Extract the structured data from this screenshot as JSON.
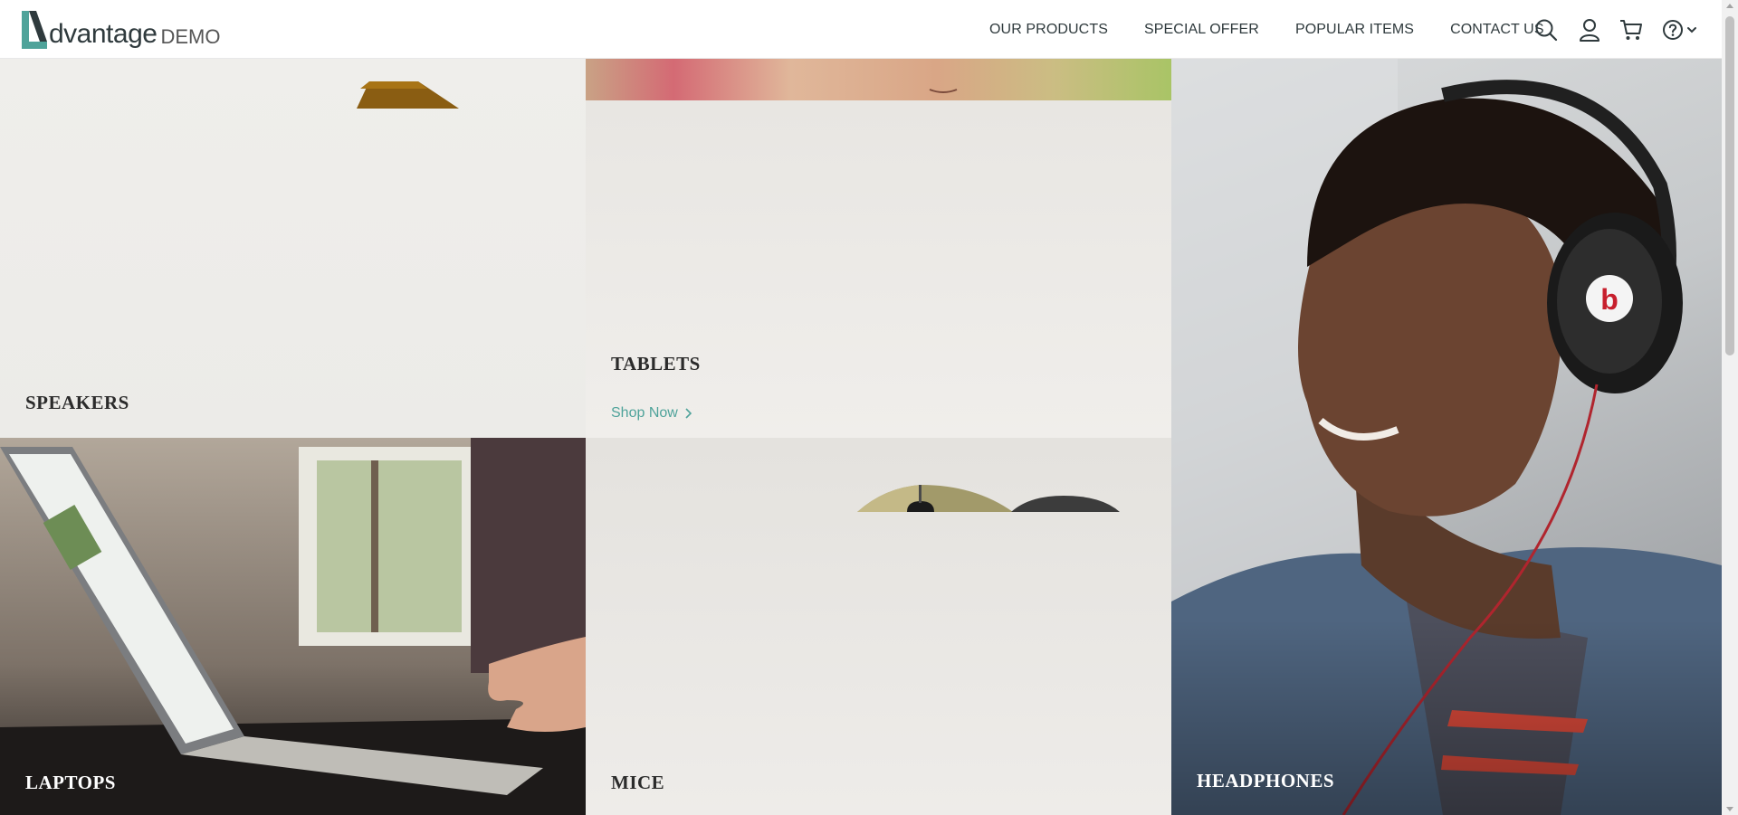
{
  "header": {
    "logo_letter": "A",
    "logo_word": "dvantage",
    "logo_suffix": "DEMO",
    "nav": [
      "OUR PRODUCTS",
      "SPECIAL OFFER",
      "POPULAR ITEMS",
      "CONTACT US"
    ],
    "icons": [
      "search-icon",
      "user-icon",
      "cart-icon",
      "help-icon",
      "chevron-down-icon"
    ]
  },
  "tiles": {
    "speakers": {
      "title": "SPEAKERS"
    },
    "tablets": {
      "title": "TABLETS",
      "cta": "Shop Now"
    },
    "headphones": {
      "title": "HEADPHONES"
    },
    "laptops": {
      "title": "LAPTOPS"
    },
    "mice": {
      "title": "MICE"
    }
  },
  "colors": {
    "accent": "#4fa39a",
    "text_dark": "#2f3a3d"
  }
}
